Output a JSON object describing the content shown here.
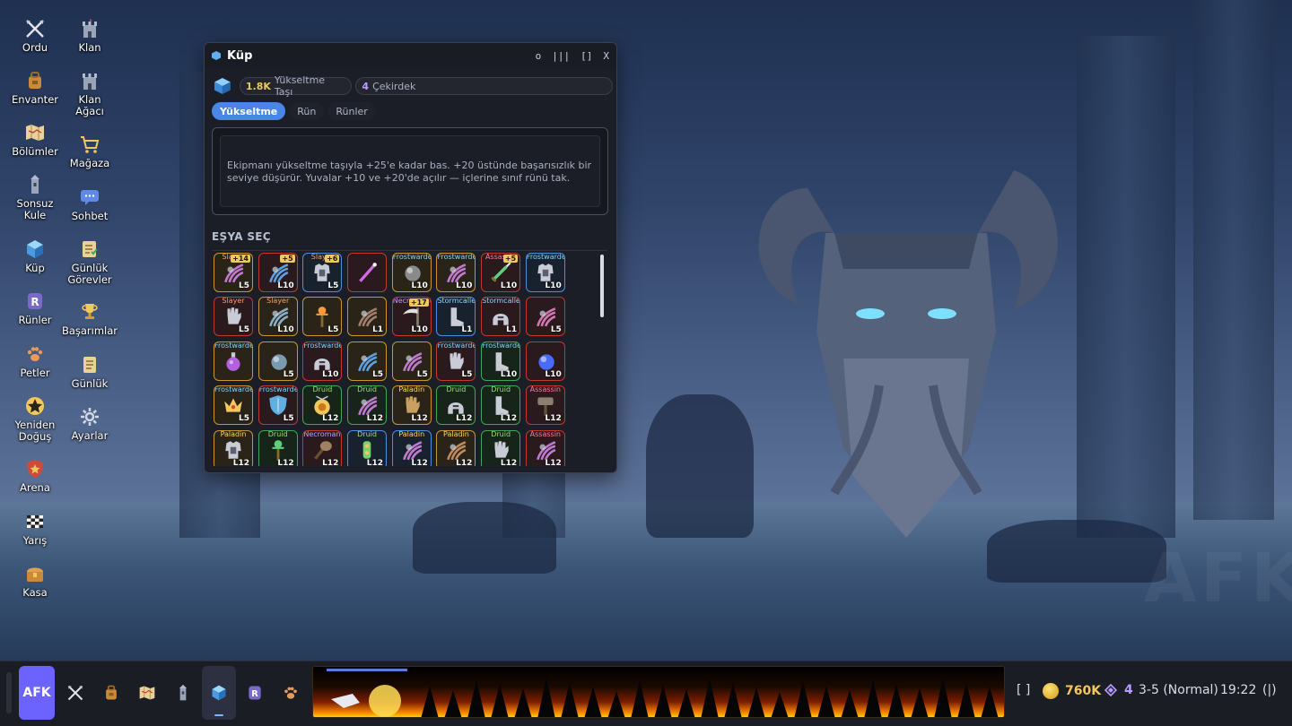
{
  "desktop": {
    "col1": [
      {
        "id": "ordu",
        "label": "Ordu",
        "icon": "crossed-swords-icon"
      },
      {
        "id": "envanter",
        "label": "Envanter",
        "icon": "backpack-icon"
      },
      {
        "id": "bolumler",
        "label": "Bölümler",
        "icon": "map-icon"
      },
      {
        "id": "sonsuz-kule",
        "label": "Sonsuz\nKule",
        "icon": "tower-icon"
      },
      {
        "id": "kup",
        "label": "Küp",
        "icon": "cube-icon"
      },
      {
        "id": "runler",
        "label": "Rünler",
        "icon": "rune-icon"
      },
      {
        "id": "petler",
        "label": "Petler",
        "icon": "paw-icon"
      },
      {
        "id": "yeniden-dogus",
        "label": "Yeniden\nDoğuş",
        "icon": "star-icon"
      },
      {
        "id": "arena",
        "label": "Arena",
        "icon": "shield-star-icon"
      },
      {
        "id": "yaris",
        "label": "Yarış",
        "icon": "checkered-flag-icon"
      },
      {
        "id": "kasa",
        "label": "Kasa",
        "icon": "chest-icon"
      }
    ],
    "col2": [
      {
        "id": "klan",
        "label": "Klan",
        "icon": "castle-icon"
      },
      {
        "id": "klan-agaci",
        "label": "Klan\nAğacı",
        "icon": "castle-tree-icon"
      },
      {
        "id": "magaza",
        "label": "Mağaza",
        "icon": "cart-icon"
      },
      {
        "id": "sohbet",
        "label": "Sohbet",
        "icon": "chat-icon"
      },
      {
        "id": "gunluk-gorevler",
        "label": "Günlük\nGörevler",
        "icon": "quest-scroll-icon"
      },
      {
        "id": "basarimlar",
        "label": "Başarımlar",
        "icon": "trophy-icon"
      },
      {
        "id": "gunluk",
        "label": "Günlük",
        "icon": "journal-icon"
      },
      {
        "id": "ayarlar",
        "label": "Ayarlar",
        "icon": "gear-icon"
      }
    ]
  },
  "window": {
    "title": "Küp",
    "controls": [
      "o",
      "|||",
      "[]",
      "X"
    ],
    "resources": [
      {
        "amount": "1.8K",
        "label": "Yükseltme Taşı"
      },
      {
        "amount": "4",
        "label": "Çekirdek"
      }
    ],
    "tabs": [
      "Yükseltme",
      "Rün",
      "Rünler"
    ],
    "active_tab": "Yükseltme",
    "description": "Ekipmanı yükseltme taşıyla +25'e kadar bas. +20 üstünde başarısızlık bir seviye düşürür. Yuvalar +10 ve +20'de açılır — içlerine sınıf rünü tak.",
    "section_title": "EŞYA SEÇ",
    "items": [
      {
        "cls": "Slayer",
        "cc": "slayer",
        "rarity": "leg",
        "level": "L5",
        "plus": "+14",
        "icon": "claw-icon",
        "hue": "#c07ad0"
      },
      {
        "cls": "",
        "cc": "",
        "rarity": "epi",
        "level": "L10",
        "plus": "+5",
        "icon": "claw-icon",
        "hue": "#5fa0e0"
      },
      {
        "cls": "Slayer",
        "cc": "slayer",
        "rarity": "rar",
        "level": "L5",
        "plus": "+6",
        "icon": "chest-armor-icon",
        "hue": "#c9ccd6"
      },
      {
        "cls": "",
        "cc": "",
        "rarity": "epi",
        "level": "",
        "plus": "",
        "icon": "wand-icon",
        "hue": "#d06ae8"
      },
      {
        "cls": "Frostwarden",
        "cc": "frost",
        "rarity": "leg",
        "level": "L10",
        "plus": "",
        "icon": "orb-icon",
        "hue": "#8a8a8a"
      },
      {
        "cls": "Frostwarden",
        "cc": "frost",
        "rarity": "leg",
        "level": "L10",
        "plus": "",
        "icon": "claw-icon",
        "hue": "#c07ad0"
      },
      {
        "cls": "Assassin",
        "cc": "assassin",
        "rarity": "epi",
        "level": "L10",
        "plus": "+5",
        "icon": "dagger-icon",
        "hue": "#5fd07a"
      },
      {
        "cls": "Frostwarden",
        "cc": "frost",
        "rarity": "rar",
        "level": "L10",
        "plus": "",
        "icon": "chest-armor-icon",
        "hue": "#c9ccd6"
      },
      {
        "cls": "Slayer",
        "cc": "slayer",
        "rarity": "epi",
        "level": "L5",
        "plus": "",
        "icon": "glove-icon",
        "hue": "#c9ccd6"
      },
      {
        "cls": "Slayer",
        "cc": "slayer",
        "rarity": "leg",
        "level": "L10",
        "plus": "",
        "icon": "claw-icon",
        "hue": "#8ab0c8"
      },
      {
        "cls": "",
        "cc": "",
        "rarity": "leg",
        "level": "L5",
        "plus": "",
        "icon": "staff-icon",
        "hue": "#ff9a3c"
      },
      {
        "cls": "",
        "cc": "",
        "rarity": "leg",
        "level": "L1",
        "plus": "",
        "icon": "claw-icon",
        "hue": "#a08070"
      },
      {
        "cls": "Necromancer",
        "cc": "necro",
        "rarity": "epi",
        "level": "L10",
        "plus": "+17",
        "icon": "scythe-icon",
        "hue": "#e0e0e0"
      },
      {
        "cls": "Stormcaller",
        "cc": "storm",
        "rarity": "rar",
        "level": "L1",
        "plus": "",
        "icon": "boot-icon",
        "hue": "#c9ccd6"
      },
      {
        "cls": "Stormcaller",
        "cc": "storm",
        "rarity": "epi",
        "level": "L1",
        "plus": "",
        "icon": "helmet-icon",
        "hue": "#c9ccd6"
      },
      {
        "cls": "",
        "cc": "",
        "rarity": "epi",
        "level": "L5",
        "plus": "",
        "icon": "claw-icon",
        "hue": "#d07ab0"
      },
      {
        "cls": "Frostwarden",
        "cc": "frost",
        "rarity": "leg",
        "level": "",
        "plus": "",
        "icon": "potion-icon",
        "hue": "#b060e0"
      },
      {
        "cls": "",
        "cc": "",
        "rarity": "leg",
        "level": "L5",
        "plus": "",
        "icon": "orb-icon",
        "hue": "#7a9ab0"
      },
      {
        "cls": "Frostwarden",
        "cc": "frost",
        "rarity": "epi",
        "level": "L10",
        "plus": "",
        "icon": "helmet-icon",
        "hue": "#c9ccd6"
      },
      {
        "cls": "",
        "cc": "",
        "rarity": "leg",
        "level": "L5",
        "plus": "",
        "icon": "claw-icon",
        "hue": "#5fa0e0"
      },
      {
        "cls": "",
        "cc": "",
        "rarity": "leg",
        "level": "L5",
        "plus": "",
        "icon": "claw-icon",
        "hue": "#c07ad0"
      },
      {
        "cls": "Frostwarden",
        "cc": "frost",
        "rarity": "epi",
        "level": "L5",
        "plus": "",
        "icon": "glove-icon",
        "hue": "#c9ccd6"
      },
      {
        "cls": "Frostwarden",
        "cc": "frost",
        "rarity": "unc",
        "level": "L10",
        "plus": "",
        "icon": "boot-icon",
        "hue": "#c9ccd6"
      },
      {
        "cls": "",
        "cc": "",
        "rarity": "epi",
        "level": "L10",
        "plus": "",
        "icon": "orb-icon",
        "hue": "#4a6aff"
      },
      {
        "cls": "Frostwarden",
        "cc": "frost",
        "rarity": "leg",
        "level": "L5",
        "plus": "",
        "icon": "crown-icon",
        "hue": "#f2c75c"
      },
      {
        "cls": "Frostwarden",
        "cc": "frost",
        "rarity": "epi",
        "level": "L5",
        "plus": "",
        "icon": "shield-icon",
        "hue": "#5fb0e0"
      },
      {
        "cls": "Druid",
        "cc": "druid",
        "rarity": "unc",
        "level": "L12",
        "plus": "",
        "icon": "amulet-icon",
        "hue": "#f2c75c"
      },
      {
        "cls": "Druid",
        "cc": "druid",
        "rarity": "unc",
        "level": "L12",
        "plus": "",
        "icon": "claw-icon",
        "hue": "#c07ad0"
      },
      {
        "cls": "Paladin",
        "cc": "paladin",
        "rarity": "leg",
        "level": "L12",
        "plus": "",
        "icon": "glove-icon",
        "hue": "#c9a060"
      },
      {
        "cls": "Druid",
        "cc": "druid",
        "rarity": "unc",
        "level": "L12",
        "plus": "",
        "icon": "helmet-icon",
        "hue": "#c9ccd6"
      },
      {
        "cls": "Druid",
        "cc": "druid",
        "rarity": "unc",
        "level": "L12",
        "plus": "",
        "icon": "boot-icon",
        "hue": "#c9ccd6"
      },
      {
        "cls": "Assassin",
        "cc": "assassin",
        "rarity": "epi",
        "level": "L12",
        "plus": "",
        "icon": "hammer-icon",
        "hue": "#8a8070"
      },
      {
        "cls": "Paladin",
        "cc": "paladin",
        "rarity": "leg",
        "level": "L12",
        "plus": "",
        "icon": "chest-armor-icon",
        "hue": "#c9ccd6"
      },
      {
        "cls": "Druid",
        "cc": "druid",
        "rarity": "unc",
        "level": "L12",
        "plus": "",
        "icon": "staff-icon",
        "hue": "#5fd07a"
      },
      {
        "cls": "Necromancer",
        "cc": "necro",
        "rarity": "epi",
        "level": "L12",
        "plus": "",
        "icon": "club-icon",
        "hue": "#a08060"
      },
      {
        "cls": "Druid",
        "cc": "druid",
        "rarity": "rar",
        "level": "L12",
        "plus": "",
        "icon": "ring-icon",
        "hue": "#7ad070"
      },
      {
        "cls": "Paladin",
        "cc": "paladin",
        "rarity": "rar",
        "level": "L12",
        "plus": "",
        "icon": "claw-icon",
        "hue": "#c07ad0"
      },
      {
        "cls": "Paladin",
        "cc": "paladin",
        "rarity": "leg",
        "level": "L12",
        "plus": "",
        "icon": "claw-icon",
        "hue": "#c08a60"
      },
      {
        "cls": "Druid",
        "cc": "druid",
        "rarity": "unc",
        "level": "L12",
        "plus": "",
        "icon": "glove-icon",
        "hue": "#c9ccd6"
      },
      {
        "cls": "Assassin",
        "cc": "assassin",
        "rarity": "epi",
        "level": "L12",
        "plus": "",
        "icon": "claw-icon",
        "hue": "#c07ad0"
      }
    ]
  },
  "taskbar": {
    "afk_label": "AFK",
    "apps": [
      {
        "id": "ordu",
        "icon": "crossed-swords-icon"
      },
      {
        "id": "envanter",
        "icon": "backpack-icon"
      },
      {
        "id": "bolumler",
        "icon": "map-icon"
      },
      {
        "id": "sonsuz-kule",
        "icon": "tower-icon"
      },
      {
        "id": "kup",
        "icon": "cube-icon",
        "active": true
      },
      {
        "id": "runler",
        "icon": "rune-icon"
      },
      {
        "id": "petler",
        "icon": "paw-icon"
      }
    ],
    "bracket": "[ ]",
    "gold": "760K",
    "gems": "4",
    "stage": "3-5 (Normal)",
    "clock": "19:22",
    "end_glyph": "(|)"
  },
  "watermark": "AFK",
  "colors": {
    "accent": "#4a86e8",
    "afk": "#6c63ff",
    "gold": "#f2c75c",
    "gem": "#b89cff"
  }
}
